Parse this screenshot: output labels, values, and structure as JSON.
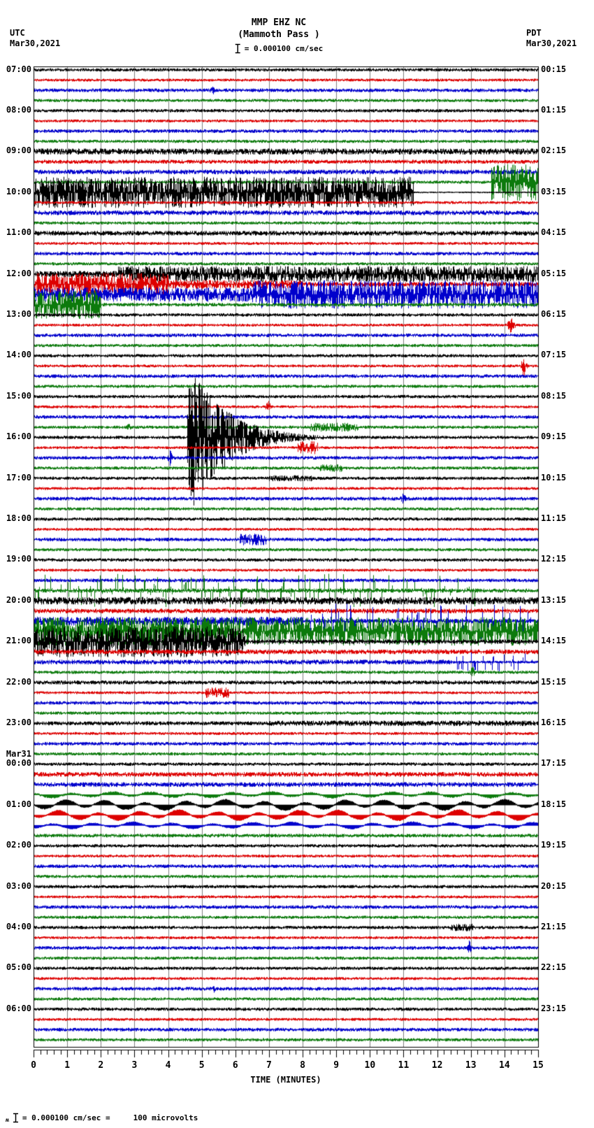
{
  "header": {
    "utc_label": "UTC",
    "utc_date": "Mar30,2021",
    "pdt_label": "PDT",
    "pdt_date": "Mar30,2021",
    "station": "MMP EHZ NC",
    "location": "(Mammoth Pass )",
    "scale_text": "= 0.000100 cm/sec"
  },
  "footer": {
    "prefix": "ʍ",
    "scale_text": "= 0.000100 cm/sec =",
    "value_text": "100 microvolts"
  },
  "chart_data": {
    "type": "seismogram-helicorder",
    "station": "MMP EHZ NC",
    "location": "(Mammoth Pass )",
    "timezone_left": "UTC",
    "timezone_right": "PDT",
    "date_start": "Mar30,2021",
    "date_rollover": "Mar31",
    "minutes_per_line": 15,
    "rows": 96,
    "xlabel": "TIME (MINUTES)",
    "x_ticks": [
      "0",
      "1",
      "2",
      "3",
      "4",
      "5",
      "6",
      "7",
      "8",
      "9",
      "10",
      "11",
      "12",
      "13",
      "14",
      "15"
    ],
    "grid_on": true,
    "grid_color": "#808080",
    "trace_colors": [
      "#000000",
      "#dd0000",
      "#0000cc",
      "#0c7a0c"
    ],
    "base_amp_defaults": [
      2.0,
      1.7,
      2.2,
      1.9
    ],
    "base_amp_overrides": {
      "8": 4,
      "9": 2.5,
      "10": 3,
      "14": 3,
      "16": 3,
      "20": 4,
      "21": 3,
      "22": 2.5,
      "23": 2.2,
      "51": 2.5,
      "52": 5,
      "53": 3,
      "56": 2.8,
      "57": 3,
      "58": 3,
      "60": 2.5,
      "64": 2.5,
      "69": 3,
      "70": 3,
      "71": 3,
      "72": 2.2,
      "73": 2,
      "75": 2.2
    },
    "left_labels": [
      {
        "row": 0,
        "text": "07:00"
      },
      {
        "row": 4,
        "text": "08:00"
      },
      {
        "row": 8,
        "text": "09:00"
      },
      {
        "row": 12,
        "text": "10:00"
      },
      {
        "row": 16,
        "text": "11:00"
      },
      {
        "row": 20,
        "text": "12:00"
      },
      {
        "row": 24,
        "text": "13:00"
      },
      {
        "row": 28,
        "text": "14:00"
      },
      {
        "row": 32,
        "text": "15:00"
      },
      {
        "row": 36,
        "text": "16:00"
      },
      {
        "row": 40,
        "text": "17:00"
      },
      {
        "row": 44,
        "text": "18:00"
      },
      {
        "row": 48,
        "text": "19:00"
      },
      {
        "row": 52,
        "text": "20:00"
      },
      {
        "row": 56,
        "text": "21:00"
      },
      {
        "row": 60,
        "text": "22:00"
      },
      {
        "row": 64,
        "text": "23:00"
      },
      {
        "row": 67.1,
        "text": "Mar31"
      },
      {
        "row": 68,
        "text": "00:00"
      },
      {
        "row": 72,
        "text": "01:00"
      },
      {
        "row": 76,
        "text": "02:00"
      },
      {
        "row": 80,
        "text": "03:00"
      },
      {
        "row": 84,
        "text": "04:00"
      },
      {
        "row": 88,
        "text": "05:00"
      },
      {
        "row": 92,
        "text": "06:00"
      }
    ],
    "right_labels": [
      {
        "row": 0,
        "text": "00:15"
      },
      {
        "row": 4,
        "text": "01:15"
      },
      {
        "row": 8,
        "text": "02:15"
      },
      {
        "row": 12,
        "text": "03:15"
      },
      {
        "row": 16,
        "text": "04:15"
      },
      {
        "row": 20,
        "text": "05:15"
      },
      {
        "row": 24,
        "text": "06:15"
      },
      {
        "row": 28,
        "text": "07:15"
      },
      {
        "row": 32,
        "text": "08:15"
      },
      {
        "row": 36,
        "text": "09:15"
      },
      {
        "row": 40,
        "text": "10:15"
      },
      {
        "row": 44,
        "text": "11:15"
      },
      {
        "row": 48,
        "text": "12:15"
      },
      {
        "row": 52,
        "text": "13:15"
      },
      {
        "row": 56,
        "text": "14:15"
      },
      {
        "row": 60,
        "text": "15:15"
      },
      {
        "row": 64,
        "text": "16:15"
      },
      {
        "row": 68,
        "text": "17:15"
      },
      {
        "row": 72,
        "text": "18:15"
      },
      {
        "row": 76,
        "text": "19:15"
      },
      {
        "row": 80,
        "text": "20:15"
      },
      {
        "row": 84,
        "text": "21:15"
      },
      {
        "row": 88,
        "text": "22:15"
      },
      {
        "row": 92,
        "text": "23:15"
      }
    ],
    "events": [
      [
        2,
        5.2,
        5.45,
        7,
        "s"
      ],
      [
        11,
        13.6,
        15,
        26,
        "n"
      ],
      [
        12,
        0,
        11.3,
        22,
        "n"
      ],
      [
        12,
        11.3,
        15,
        0.8,
        "f"
      ],
      [
        20,
        2.5,
        15,
        11,
        "n"
      ],
      [
        21,
        0,
        4,
        16,
        "n"
      ],
      [
        21,
        4,
        8,
        6,
        "n"
      ],
      [
        22,
        0,
        6.5,
        10,
        "n"
      ],
      [
        22,
        6.5,
        15,
        20,
        "n"
      ],
      [
        23,
        0,
        2,
        20,
        "n"
      ],
      [
        25,
        14.05,
        14.35,
        16,
        "s"
      ],
      [
        29,
        14.45,
        14.7,
        18,
        "s"
      ],
      [
        33,
        6.85,
        7.1,
        9,
        "s"
      ],
      [
        35,
        2.7,
        2.95,
        5,
        "s"
      ],
      [
        35,
        8.2,
        9.7,
        6,
        "n"
      ],
      [
        36,
        4.55,
        11,
        110,
        "q"
      ],
      [
        37,
        7.85,
        8.45,
        9,
        "n"
      ],
      [
        38,
        3.95,
        4.15,
        12,
        "s"
      ],
      [
        39,
        8.5,
        9.2,
        5,
        "n"
      ],
      [
        40,
        7.0,
        8.3,
        4,
        "n"
      ],
      [
        42,
        10.85,
        11.1,
        9,
        "s"
      ],
      [
        46,
        6.1,
        6.9,
        8,
        "n"
      ],
      [
        51,
        0,
        13.2,
        15,
        "p"
      ],
      [
        54,
        0,
        8,
        6,
        "n"
      ],
      [
        54,
        8,
        15,
        16,
        "p"
      ],
      [
        55,
        0,
        15,
        20,
        "n"
      ],
      [
        56,
        0,
        6.3,
        22,
        "n"
      ],
      [
        58,
        12.5,
        15,
        9,
        "p"
      ],
      [
        59,
        12.9,
        13.15,
        10,
        "s"
      ],
      [
        61,
        5.1,
        5.8,
        7,
        "n"
      ],
      [
        64,
        7,
        15,
        3.5,
        "n"
      ],
      [
        71,
        0,
        15,
        2.5,
        "l"
      ],
      [
        72,
        0,
        15,
        5,
        "l"
      ],
      [
        73,
        0,
        15,
        5,
        "l"
      ],
      [
        74,
        0,
        15,
        3,
        "l"
      ],
      [
        84,
        12.4,
        13.1,
        5,
        "n"
      ],
      [
        86,
        12.85,
        13.05,
        11,
        "s"
      ],
      [
        90,
        5.25,
        5.45,
        6,
        "s"
      ]
    ]
  }
}
